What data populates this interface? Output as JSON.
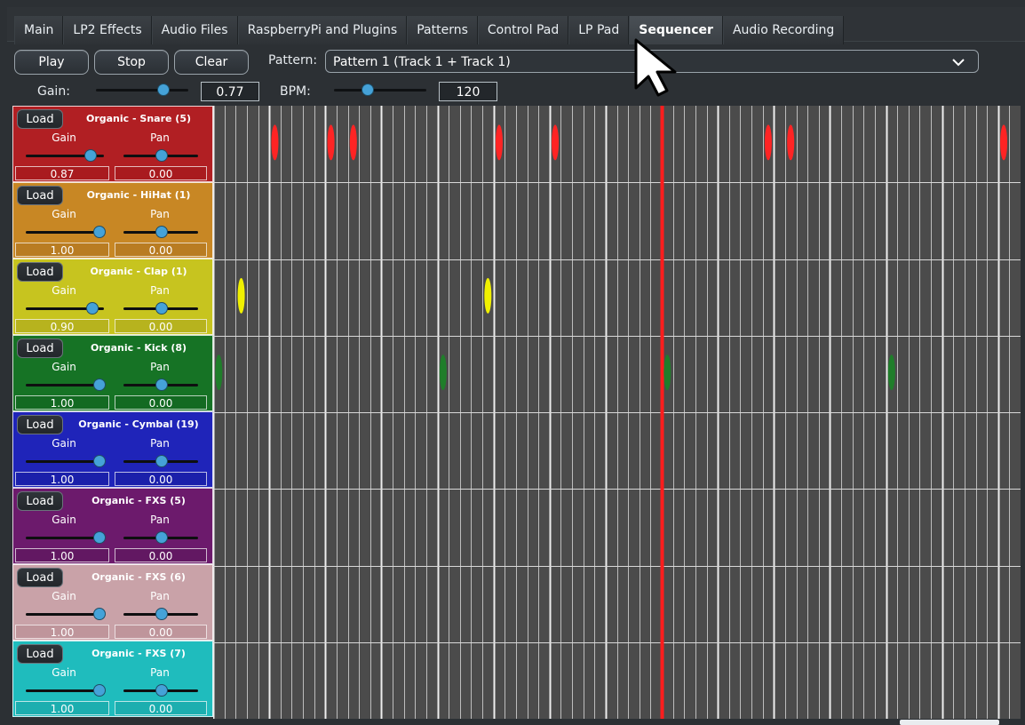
{
  "tabs": [
    {
      "label": "Main",
      "active": false
    },
    {
      "label": "LP2 Effects",
      "active": false
    },
    {
      "label": "Audio Files",
      "active": false
    },
    {
      "label": "RaspberryPi and Plugins",
      "active": false
    },
    {
      "label": "Patterns",
      "active": false
    },
    {
      "label": "Control Pad",
      "active": false
    },
    {
      "label": "LP Pad",
      "active": false
    },
    {
      "label": "Sequencer",
      "active": true
    },
    {
      "label": "Audio Recording",
      "active": false
    }
  ],
  "controls": {
    "play_label": "Play",
    "stop_label": "Stop",
    "clear_label": "Clear",
    "pattern_label": "Pattern:",
    "pattern_value": "Pattern 1 (Track 1 + Track 1)",
    "gain_label": "Gain:",
    "gain_value": "0.77",
    "gain_fraction": 0.77,
    "bpm_label": "BPM:",
    "bpm_value": "120",
    "bpm_fraction": 0.35
  },
  "tracks": [
    {
      "load": "Load",
      "name": "Organic - Snare (5)",
      "gain_label": "Gain",
      "pan_label": "Pan",
      "gain": "0.87",
      "pan": "0.00",
      "gain_fraction": 0.87,
      "pan_fraction": 0.5,
      "color": "#b11f23",
      "value_box_bg": "#a91b1f",
      "notes": [
        {
          "col": 5,
          "kind": "red"
        },
        {
          "col": 10,
          "kind": "red"
        },
        {
          "col": 12,
          "kind": "red"
        },
        {
          "col": 25,
          "kind": "red"
        },
        {
          "col": 30,
          "kind": "red"
        },
        {
          "col": 49,
          "kind": "red"
        },
        {
          "col": 51,
          "kind": "red"
        },
        {
          "col": 70,
          "kind": "red"
        }
      ]
    },
    {
      "load": "Load",
      "name": "Organic - HiHat (1)",
      "gain_label": "Gain",
      "pan_label": "Pan",
      "gain": "1.00",
      "pan": "0.00",
      "gain_fraction": 1.0,
      "pan_fraction": 0.5,
      "color": "#c88724",
      "value_box_bg": "#b97c22",
      "notes": []
    },
    {
      "load": "Load",
      "name": "Organic - Clap (1)",
      "gain_label": "Gain",
      "pan_label": "Pan",
      "gain": "0.90",
      "pan": "0.00",
      "gain_fraction": 0.9,
      "pan_fraction": 0.5,
      "color": "#c7c41f",
      "value_box_bg": "#b7b31e",
      "notes": [
        {
          "col": 2,
          "kind": "yellow"
        },
        {
          "col": 24,
          "kind": "yellow"
        }
      ]
    },
    {
      "load": "Load",
      "name": "Organic - Kick (8)",
      "gain_label": "Gain",
      "pan_label": "Pan",
      "gain": "1.00",
      "pan": "0.00",
      "gain_fraction": 1.0,
      "pan_fraction": 0.5,
      "color": "#167325",
      "value_box_bg": "#136a22",
      "notes": [
        {
          "col": 0,
          "kind": "green"
        },
        {
          "col": 20,
          "kind": "green"
        },
        {
          "col": 40,
          "kind": "green"
        },
        {
          "col": 60,
          "kind": "green"
        }
      ]
    },
    {
      "load": "Load",
      "name": "Organic - Cymbal (19)",
      "gain_label": "Gain",
      "pan_label": "Pan",
      "gain": "1.00",
      "pan": "0.00",
      "gain_fraction": 1.0,
      "pan_fraction": 0.5,
      "color": "#1f24b9",
      "value_box_bg": "#1b20aa",
      "notes": []
    },
    {
      "load": "Load",
      "name": "Organic - FXS (5)",
      "gain_label": "Gain",
      "pan_label": "Pan",
      "gain": "1.00",
      "pan": "0.00",
      "gain_fraction": 1.0,
      "pan_fraction": 0.5,
      "color": "#6c1a6c",
      "value_box_bg": "#621862",
      "notes": []
    },
    {
      "load": "Load",
      "name": "Organic - FXS (6)",
      "gain_label": "Gain",
      "pan_label": "Pan",
      "gain": "1.00",
      "pan": "0.00",
      "gain_fraction": 1.0,
      "pan_fraction": 0.5,
      "color": "#c9a2a8",
      "value_box_bg": "#bf959b",
      "notes": []
    },
    {
      "load": "Load",
      "name": "Organic - FXS (7)",
      "gain_label": "Gain",
      "pan_label": "Pan",
      "gain": "1.00",
      "pan": "0.00",
      "gain_fraction": 1.0,
      "pan_fraction": 0.5,
      "color": "#1fbcbd",
      "value_box_bg": "#1caeaf",
      "notes": []
    }
  ],
  "sequencer": {
    "steps": 72,
    "steps_per_beat": 5,
    "playhead_step": 40,
    "colors": {
      "bg": "#4b4b4b",
      "thin": "#bdbdbd",
      "major": "#eeeeee",
      "playhead": "#ff1d1d",
      "red": "#ff2424",
      "yellow": "#f0f000",
      "green": "#1f7e2a"
    }
  }
}
